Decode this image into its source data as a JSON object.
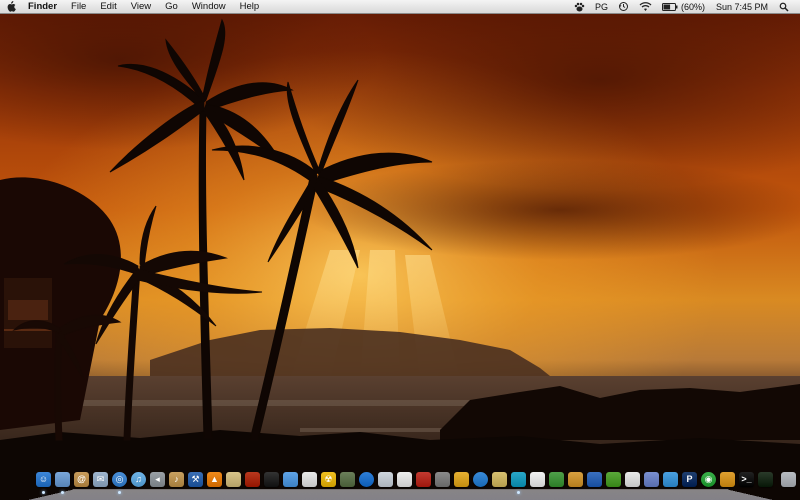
{
  "menubar": {
    "apple_icon": "apple-logo-icon",
    "app_name": "Finder",
    "menus": [
      "File",
      "Edit",
      "View",
      "Go",
      "Window",
      "Help"
    ],
    "status": {
      "input_source": "PG",
      "battery_percent": "(60%)",
      "battery_level": 0.6,
      "clock": "Sun 7:45 PM",
      "icons": [
        "paw-icon",
        "time-machine-icon",
        "wifi-icon",
        "battery-icon",
        "spotlight-icon"
      ]
    }
  },
  "wallpaper": {
    "description_colors": {
      "sky_top": "#8a2a06",
      "sky_glow": "#f2a22a",
      "horizon": "#c98a3a",
      "sea": "#2a1a0e",
      "silhouette": "#0f0603"
    }
  },
  "dock": {
    "items": [
      {
        "name": "finder",
        "color": "#3d86d8",
        "glyph": "☺",
        "running": true
      },
      {
        "name": "preview",
        "color": "#7aa6d9",
        "glyph": "",
        "running": true
      },
      {
        "name": "contacts",
        "color": "#c89c5c",
        "glyph": "@",
        "running": false
      },
      {
        "name": "mail",
        "color": "#9fb6cf",
        "glyph": "✉",
        "running": false
      },
      {
        "name": "safari",
        "color": "#4a8fd8",
        "glyph": "◎",
        "running": true
      },
      {
        "name": "itunes",
        "color": "#6fb4e8",
        "glyph": "♫",
        "running": false
      },
      {
        "name": "speaker",
        "color": "#9aa0a6",
        "glyph": "◂",
        "running": false
      },
      {
        "name": "garageband",
        "color": "#c8a060",
        "glyph": "♪",
        "running": false
      },
      {
        "name": "xcode",
        "color": "#3b6fb5",
        "glyph": "⚒",
        "running": false
      },
      {
        "name": "vlc",
        "color": "#f08a1a",
        "glyph": "▲",
        "running": false
      },
      {
        "name": "notes",
        "color": "#d8c48a",
        "glyph": "",
        "running": false
      },
      {
        "name": "photo-booth",
        "color": "#b8381e",
        "glyph": "",
        "running": false
      },
      {
        "name": "clapboard",
        "color": "#333333",
        "glyph": "",
        "running": false
      },
      {
        "name": "imovie",
        "color": "#5fa3e6",
        "glyph": "",
        "running": false
      },
      {
        "name": "chrome",
        "color": "#e8e8e8",
        "glyph": "",
        "running": false
      },
      {
        "name": "radiation",
        "color": "#f0c020",
        "glyph": "☢",
        "running": false
      },
      {
        "name": "utility",
        "color": "#6b7f5a",
        "glyph": "",
        "running": false
      },
      {
        "name": "dictionary",
        "color": "#2f7fd8",
        "glyph": "",
        "running": false
      },
      {
        "name": "photos",
        "color": "#cfd6de",
        "glyph": "",
        "running": false
      },
      {
        "name": "textedit",
        "color": "#eeeeee",
        "glyph": "",
        "running": false
      },
      {
        "name": "book",
        "color": "#c23a30",
        "glyph": "",
        "running": false
      },
      {
        "name": "wrench",
        "color": "#8a8a8a",
        "glyph": "",
        "running": false
      },
      {
        "name": "crayons",
        "color": "#e6b032",
        "glyph": "",
        "running": false
      },
      {
        "name": "earth",
        "color": "#3a8bd8",
        "glyph": "",
        "running": false
      },
      {
        "name": "palette",
        "color": "#d8c070",
        "glyph": "",
        "running": false
      },
      {
        "name": "pen",
        "color": "#2aa7c8",
        "glyph": "",
        "running": true
      },
      {
        "name": "document",
        "color": "#f2f2f2",
        "glyph": "",
        "running": false
      },
      {
        "name": "bird",
        "color": "#4fa04a",
        "glyph": "",
        "running": false
      },
      {
        "name": "paint",
        "color": "#d8a040",
        "glyph": "",
        "running": false
      },
      {
        "name": "cube",
        "color": "#3a70c0",
        "glyph": "",
        "running": false
      },
      {
        "name": "grass",
        "color": "#5aa83a",
        "glyph": "",
        "running": false
      },
      {
        "name": "paper",
        "color": "#e8e8e8",
        "glyph": "",
        "running": false
      },
      {
        "name": "brush",
        "color": "#7a8fd0",
        "glyph": "",
        "running": false
      },
      {
        "name": "blocks",
        "color": "#4aa0e0",
        "glyph": "",
        "running": false
      },
      {
        "name": "p-app",
        "color": "#1f3f70",
        "glyph": "P",
        "running": false
      },
      {
        "name": "green-circle",
        "color": "#3ab04a",
        "glyph": "◉",
        "running": false
      },
      {
        "name": "arrow",
        "color": "#e0a030",
        "glyph": "",
        "running": false
      },
      {
        "name": "terminal",
        "color": "#222222",
        "glyph": ">_",
        "running": false
      },
      {
        "name": "activity-monitor",
        "color": "#2a3a2a",
        "glyph": "",
        "running": false
      },
      {
        "name": "trash",
        "color": "#b8bcc2",
        "glyph": "",
        "running": false
      }
    ]
  }
}
